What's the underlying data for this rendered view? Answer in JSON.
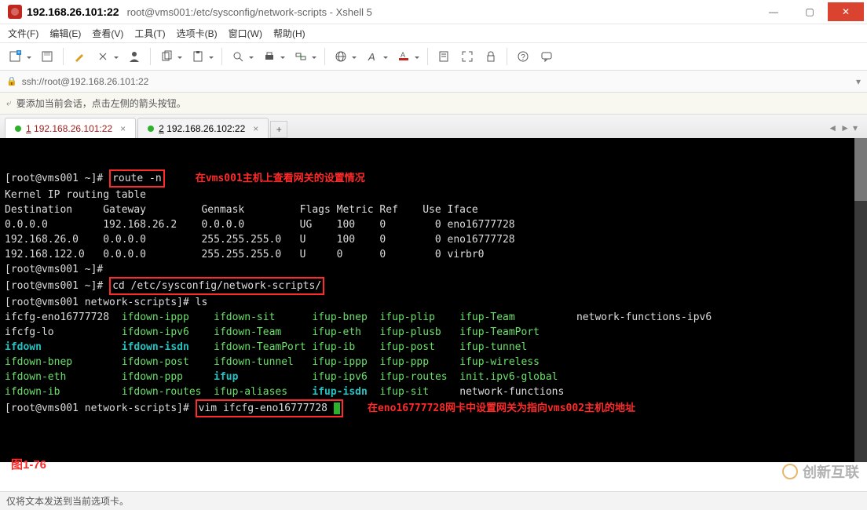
{
  "window": {
    "host": "192.168.26.101:22",
    "title_path": "root@vms001:/etc/sysconfig/network-scripts - Xshell 5",
    "min": "—",
    "max": "▢",
    "close": "✕"
  },
  "menu": {
    "file": "文件(F)",
    "edit": "编辑(E)",
    "view": "查看(V)",
    "tool": "工具(T)",
    "tabs": "选项卡(B)",
    "window": "窗口(W)",
    "help": "帮助(H)"
  },
  "address": {
    "url": "ssh://root@192.168.26.101:22"
  },
  "hint": {
    "text": "要添加当前会话，点击左侧的箭头按钮。"
  },
  "tabs": {
    "tab1_prefix": "1",
    "tab1_label": " 192.168.26.101:22",
    "tab2_prefix": "2",
    "tab2_label": " 192.168.26.102:22"
  },
  "term": {
    "line1_prompt": "[root@vms001 ~]# ",
    "line1_cmd": "route -n",
    "line1_note": "在vms001主机上查看网关的设置情况",
    "line2": "Kernel IP routing table",
    "hdr": "Destination     Gateway         Genmask         Flags Metric Ref    Use Iface",
    "r1": "0.0.0.0         192.168.26.2    0.0.0.0         UG    100    0        0 eno16777728",
    "r2": "192.168.26.0    0.0.0.0         255.255.255.0   U     100    0        0 eno16777728",
    "r3": "192.168.122.0   0.0.0.0         255.255.255.0   U     0      0        0 virbr0",
    "line_empty_prompt": "[root@vms001 ~]#",
    "line_cd_prompt": "[root@vms001 ~]# ",
    "line_cd_cmd": "cd /etc/sysconfig/network-scripts/",
    "line_ls": "[root@vms001 network-scripts]# ls",
    "ls_a1": "ifcfg-eno16777728",
    "ls_b1": "ifdown-ippp",
    "ls_c1": "ifdown-sit",
    "ls_d1": "ifup-bnep",
    "ls_e1": "ifup-plip",
    "ls_f1": "ifup-Team",
    "ls_g1": "network-functions-ipv6",
    "ls_a2": "ifcfg-lo",
    "ls_b2": "ifdown-ipv6",
    "ls_c2": "ifdown-Team",
    "ls_d2": "ifup-eth",
    "ls_e2": "ifup-plusb",
    "ls_f2": "ifup-TeamPort",
    "ls_a3": "ifdown",
    "ls_b3": "ifdown-isdn",
    "ls_c3": "ifdown-TeamPort",
    "ls_d3": "ifup-ib",
    "ls_e3": "ifup-post",
    "ls_f3": "ifup-tunnel",
    "ls_a4": "ifdown-bnep",
    "ls_b4": "ifdown-post",
    "ls_c4": "ifdown-tunnel",
    "ls_d4": "ifup-ippp",
    "ls_e4": "ifup-ppp",
    "ls_f4": "ifup-wireless",
    "ls_a5": "ifdown-eth",
    "ls_b5": "ifdown-ppp",
    "ls_c5": "ifup",
    "ls_d5": "ifup-ipv6",
    "ls_e5": "ifup-routes",
    "ls_f5": "init.ipv6-global",
    "ls_a6": "ifdown-ib",
    "ls_b6": "ifdown-routes",
    "ls_c6": "ifup-aliases",
    "ls_d6": "ifup-isdn",
    "ls_e6": "ifup-sit",
    "ls_f6": "network-functions",
    "line_vim_prompt": "[root@vms001 network-scripts]# ",
    "line_vim_cmd": "vim ifcfg-eno16777728 ",
    "line_vim_note": "在eno16777728网卡中设置网关为指向vms002主机的地址"
  },
  "figure_label": "图1-76",
  "watermark": "创新互联",
  "status": {
    "text": "仅将文本发送到当前选项卡。"
  }
}
